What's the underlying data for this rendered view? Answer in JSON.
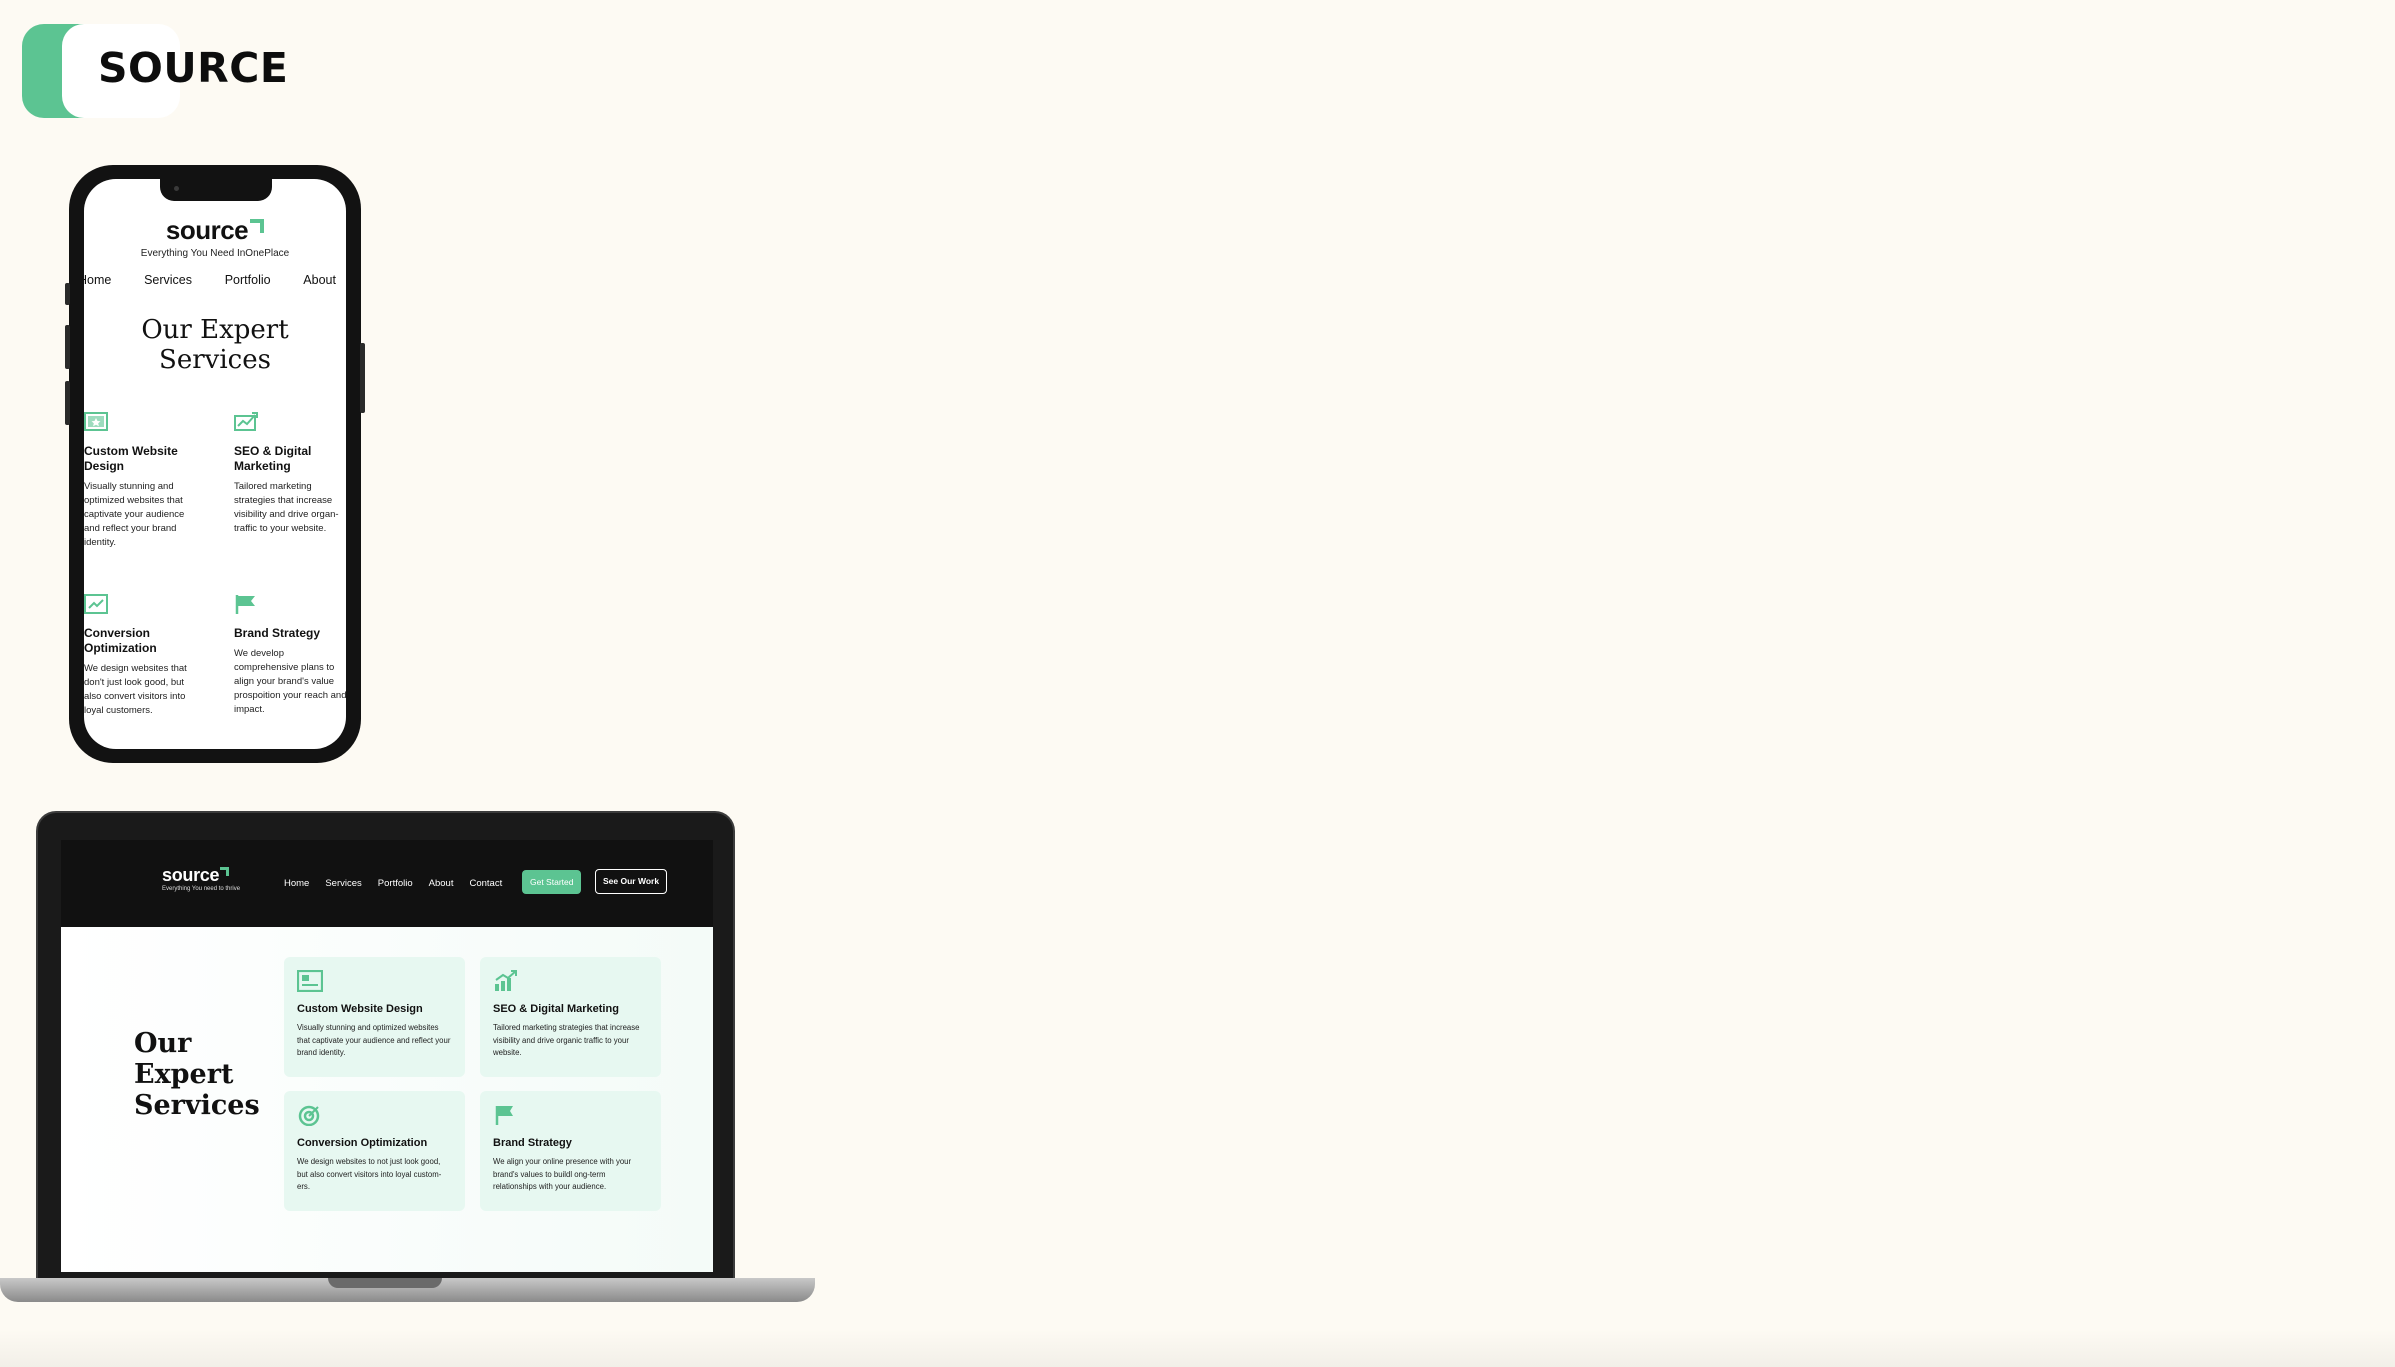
{
  "brand": {
    "label": "SOURCE"
  },
  "colors": {
    "accent": "#5cc492",
    "background": "#fdfaf3",
    "dark": "#111111"
  },
  "mobile": {
    "logo": "source",
    "tagline": "Everything You Need InOnePlace",
    "nav": [
      "Home",
      "Services",
      "Portfolio",
      "About"
    ],
    "title_line1": "Our Expert",
    "title_line2": "Services",
    "cards": [
      {
        "icon": "website-design-icon",
        "title": "Custom Website Design",
        "desc": "Visually stunning and optimized websites that captivate your audience and reflect your brand identity."
      },
      {
        "icon": "seo-marketing-icon",
        "title": "SEO & Digital Marketing",
        "desc": "Tailored marketing strategies that increase visibility and drive organ- traffic to your website."
      },
      {
        "icon": "conversion-chart-icon",
        "title": "Conversion Optimization",
        "desc": "We design websites that don't just look good, but also convert visitors into loyal customers."
      },
      {
        "icon": "brand-flag-icon",
        "title": "Brand Strategy",
        "desc": "We develop comprehensive plans to align your brand's value prospoition your reach and impact."
      }
    ]
  },
  "desktop": {
    "logo": "source",
    "tagline": "Everything You need to thrive",
    "nav": [
      "Home",
      "Services",
      "Portfolio",
      "About",
      "Contact"
    ],
    "cta_primary": "Get Started",
    "cta_secondary": "See Our Work",
    "title_line1": "Our",
    "title_line2": "Expert",
    "title_line3": "Services",
    "cards": [
      {
        "icon": "website-design-icon",
        "title": "Custom Website Design",
        "desc": "Visually stunning and optimized websites that captivate your audience and reflect your brand identity."
      },
      {
        "icon": "seo-marketing-icon",
        "title": "SEO & Digital Marketing",
        "desc": "Tailored marketing strategies that increase visibility and drive organic traffic to your website."
      },
      {
        "icon": "target-icon",
        "title": "Conversion Optimization",
        "desc": "We design websites to not just look good, but also convert visitors into loyal custom- ers."
      },
      {
        "icon": "brand-flag-icon",
        "title": "Brand Strategy",
        "desc": "We align your online presence with your brand's values to buildl ong-term relationships with your audience."
      }
    ]
  }
}
